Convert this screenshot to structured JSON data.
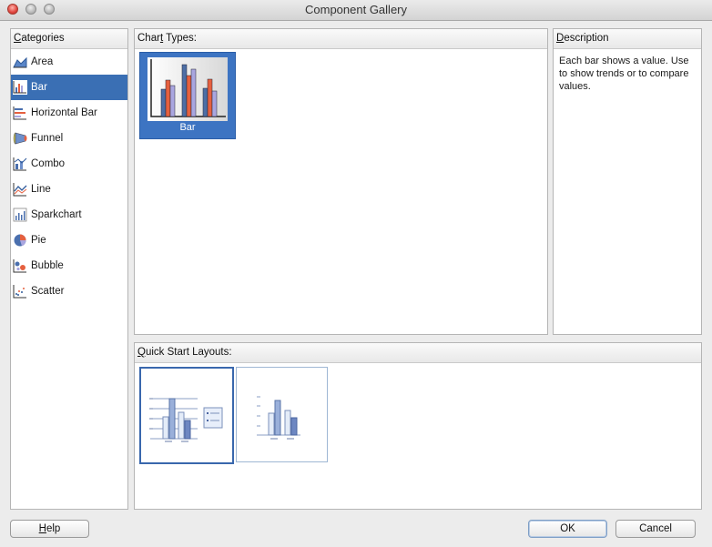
{
  "window": {
    "title": "Component Gallery"
  },
  "categories": {
    "header_mnemonic": "C",
    "header_rest": "ategories",
    "items": [
      {
        "label": "Area",
        "icon": "area-chart-icon",
        "selected": false
      },
      {
        "label": "Bar",
        "icon": "bar-chart-icon",
        "selected": true
      },
      {
        "label": "Horizontal Bar",
        "icon": "horizontal-bar-chart-icon",
        "selected": false
      },
      {
        "label": "Funnel",
        "icon": "funnel-chart-icon",
        "selected": false
      },
      {
        "label": "Combo",
        "icon": "combo-chart-icon",
        "selected": false
      },
      {
        "label": "Line",
        "icon": "line-chart-icon",
        "selected": false
      },
      {
        "label": "Sparkchart",
        "icon": "sparkchart-icon",
        "selected": false
      },
      {
        "label": "Pie",
        "icon": "pie-chart-icon",
        "selected": false
      },
      {
        "label": "Bubble",
        "icon": "bubble-chart-icon",
        "selected": false
      },
      {
        "label": "Scatter",
        "icon": "scatter-chart-icon",
        "selected": false
      }
    ]
  },
  "chart_types": {
    "header_pre": "Char",
    "header_mnemonic": "t",
    "header_post": " Types:",
    "items": [
      {
        "label": "Bar",
        "selected": true
      }
    ]
  },
  "description": {
    "header_mnemonic": "D",
    "header_rest": "escription",
    "text": "Each bar shows a value. Use to show trends or to compare values."
  },
  "quick_start": {
    "header_mnemonic": "Q",
    "header_rest": "uick Start Layouts:",
    "layouts": [
      {
        "name": "bar-with-legend-layout",
        "selected": true
      },
      {
        "name": "bar-only-layout",
        "selected": false
      }
    ]
  },
  "buttons": {
    "help_mnemonic": "H",
    "help_rest": "elp",
    "ok": "OK",
    "cancel": "Cancel"
  },
  "colors": {
    "selection": "#3a6fb4",
    "bar_blue": "#5b7fb5",
    "bar_red": "#e5603f",
    "bar_lavender": "#a9a6e0"
  }
}
